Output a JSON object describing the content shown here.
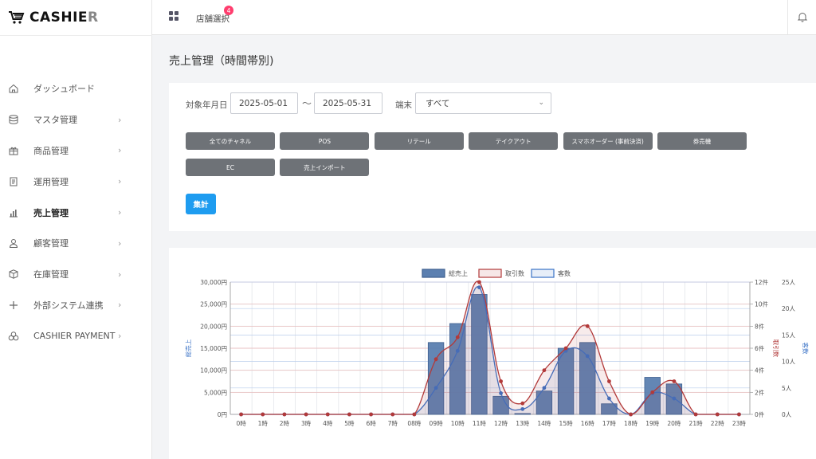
{
  "brand": {
    "name_main": "CASHIE",
    "name_last": "R"
  },
  "topbar": {
    "store_select": "店舗選択",
    "badge_count": "4"
  },
  "sidebar": {
    "items": [
      {
        "label": "ダッシュボード",
        "icon": "home-icon",
        "chevron": false,
        "active": false
      },
      {
        "label": "マスタ管理",
        "icon": "database-icon",
        "chevron": true,
        "active": false
      },
      {
        "label": "商品管理",
        "icon": "gift-icon",
        "chevron": true,
        "active": false
      },
      {
        "label": "運用管理",
        "icon": "document-icon",
        "chevron": true,
        "active": false
      },
      {
        "label": "売上管理",
        "icon": "bar-chart-icon",
        "chevron": true,
        "active": true
      },
      {
        "label": "顧客管理",
        "icon": "user-icon",
        "chevron": true,
        "active": false
      },
      {
        "label": "在庫管理",
        "icon": "box-icon",
        "chevron": true,
        "active": false
      },
      {
        "label": "外部システム連携",
        "icon": "plus-icon",
        "chevron": true,
        "active": false
      },
      {
        "label": "CASHIER PAYMENT",
        "icon": "coins-icon",
        "chevron": true,
        "active": false
      }
    ]
  },
  "page": {
    "title": "売上管理（時間帯別)"
  },
  "filters": {
    "period_label": "対象年月日",
    "date_from": "2025-05-01",
    "tilde": "〜",
    "date_to": "2025-05-31",
    "terminal_label": "端末",
    "terminal_value": "すべて",
    "channels": [
      "全てのチャネル",
      "POS",
      "リテール",
      "テイクアウト",
      "スマホオーダー (事前決済)",
      "券売機",
      "EC",
      "売上インポート"
    ],
    "aggregate_button": "集計"
  },
  "colors": {
    "bar": "#5b7fb0",
    "transactions": "#b23a3a",
    "customers": "#3a72c6",
    "accent": "#1e9cf0"
  },
  "chart_data": {
    "type": "bar",
    "categories": [
      "0時",
      "1時",
      "2時",
      "3時",
      "4時",
      "5時",
      "6時",
      "7時",
      "08時",
      "09時",
      "10時",
      "11時",
      "12時",
      "13時",
      "14時",
      "15時",
      "16時",
      "17時",
      "18時",
      "19時",
      "20時",
      "21時",
      "22時",
      "23時"
    ],
    "legend": [
      "総売上",
      "取引数",
      "客数"
    ],
    "legend_position": "top-center",
    "series": [
      {
        "name": "総売上",
        "type": "bar",
        "axis": "left",
        "values": [
          0,
          0,
          0,
          0,
          0,
          0,
          0,
          0,
          0,
          16300,
          20600,
          27200,
          4100,
          200,
          5300,
          15000,
          16300,
          2400,
          0,
          8400,
          6900,
          0,
          0,
          0
        ]
      },
      {
        "name": "取引数",
        "type": "line",
        "axis": "right1",
        "values": [
          0,
          0,
          0,
          0,
          0,
          0,
          0,
          0,
          0,
          5,
          7,
          12,
          3,
          1,
          4,
          6,
          8,
          3,
          0,
          2,
          3,
          0,
          0,
          0
        ]
      },
      {
        "name": "客数",
        "type": "line",
        "axis": "right2",
        "values": [
          0,
          0,
          0,
          0,
          0,
          0,
          0,
          0,
          0,
          5,
          12,
          24,
          4,
          1,
          5,
          12,
          11,
          3,
          0,
          4,
          3,
          0,
          0,
          0
        ]
      }
    ],
    "y_left": {
      "label": "総売上",
      "ticks": [
        "0円",
        "5,000円",
        "10,000円",
        "15,000円",
        "20,000円",
        "25,000円",
        "30,000円"
      ],
      "ylim": [
        0,
        30000
      ]
    },
    "y_right1": {
      "label": "取引数",
      "ticks": [
        "0件",
        "2件",
        "4件",
        "6件",
        "8件",
        "10件",
        "12件"
      ],
      "ylim": [
        0,
        12
      ]
    },
    "y_right2": {
      "label": "客数",
      "ticks": [
        "0人",
        "5人",
        "10人",
        "15人",
        "20人",
        "25人"
      ],
      "ylim": [
        0,
        25
      ]
    },
    "grid": true
  }
}
